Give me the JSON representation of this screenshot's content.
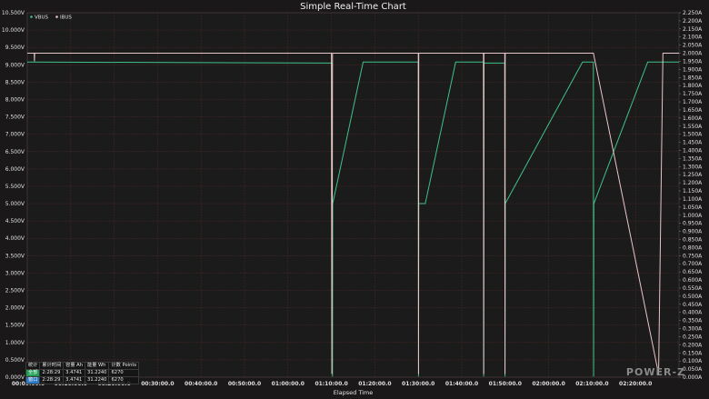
{
  "chart_data": {
    "type": "line",
    "title": "Simple Real-Time Chart",
    "xlabel": "Elapsed Time",
    "x_ticks": [
      "00:00:00.0",
      "00:10:00.0",
      "00:20:00.0",
      "00:30:00.0",
      "00:40:00.0",
      "00:50:00.0",
      "01:00:00.0",
      "01:10:00.0",
      "01:20:00.0",
      "01:30:00.0",
      "01:40:00.0",
      "01:50:00.0",
      "02:00:00.0",
      "02:10:00.0",
      "02:20:00.0"
    ],
    "x_range_minutes": [
      0,
      150
    ],
    "y_left": {
      "ticks": [
        "0.000V",
        "0.500V",
        "1.000V",
        "1.500V",
        "2.000V",
        "2.500V",
        "3.000V",
        "3.500V",
        "4.000V",
        "4.500V",
        "5.000V",
        "5.500V",
        "6.000V",
        "6.500V",
        "7.000V",
        "7.500V",
        "8.000V",
        "8.500V",
        "9.000V",
        "9.500V",
        "10.000V",
        "10.500V"
      ],
      "range": [
        0,
        10.5
      ]
    },
    "y_right": {
      "ticks": [
        "0.000A",
        "0.050A",
        "0.100A",
        "0.150A",
        "0.200A",
        "0.250A",
        "0.300A",
        "0.350A",
        "0.400A",
        "0.450A",
        "0.500A",
        "0.550A",
        "0.600A",
        "0.650A",
        "0.700A",
        "0.750A",
        "0.800A",
        "0.850A",
        "0.900A",
        "0.950A",
        "1.000A",
        "1.050A",
        "1.100A",
        "1.150A",
        "1.200A",
        "1.250A",
        "1.300A",
        "1.350A",
        "1.400A",
        "1.450A",
        "1.500A",
        "1.550A",
        "1.600A",
        "1.650A",
        "1.700A",
        "1.750A",
        "1.800A",
        "1.850A",
        "1.900A",
        "1.950A",
        "2.000A",
        "2.050A",
        "2.100A",
        "2.150A",
        "2.200A",
        "2.250A"
      ],
      "range": [
        0,
        2.25
      ]
    },
    "legend_position": "top-left",
    "grid": true,
    "series": [
      {
        "name": "VBUS",
        "color": "#3fc28a",
        "axis": "left",
        "points": [
          [
            0,
            9.08
          ],
          [
            70.2,
            9.05
          ],
          [
            70.25,
            0.02
          ],
          [
            70.3,
            5.0
          ],
          [
            77.3,
            9.08
          ],
          [
            90,
            9.08
          ],
          [
            90.05,
            0.02
          ],
          [
            90.1,
            5.0
          ],
          [
            91.6,
            5.0
          ],
          [
            98.6,
            9.08
          ],
          [
            105,
            9.08
          ],
          [
            105.05,
            0.02
          ],
          [
            105.1,
            9.05
          ],
          [
            109.9,
            9.05
          ],
          [
            109.95,
            0.02
          ],
          [
            110,
            5.0
          ],
          [
            127.8,
            9.08
          ],
          [
            130.3,
            9.08
          ],
          [
            130.35,
            0.02
          ],
          [
            130.4,
            5.0
          ],
          [
            142.8,
            9.08
          ],
          [
            150,
            9.08
          ]
        ]
      },
      {
        "name": "IBUS",
        "color": "#e8c6c8",
        "axis": "right",
        "points": [
          [
            0,
            2.0
          ],
          [
            1.6,
            2.0
          ],
          [
            1.65,
            1.95
          ],
          [
            1.7,
            2.0
          ],
          [
            70.0,
            2.0
          ],
          [
            70.1,
            0.02
          ],
          [
            70.25,
            2.0
          ],
          [
            90,
            2.0
          ],
          [
            90.05,
            0.02
          ],
          [
            90.1,
            2.0
          ],
          [
            105,
            2.0
          ],
          [
            105.05,
            0.02
          ],
          [
            105.1,
            2.0
          ],
          [
            109.9,
            2.0
          ],
          [
            109.95,
            0.02
          ],
          [
            110,
            2.0
          ],
          [
            130.3,
            2.0
          ],
          [
            145.3,
            0.02
          ],
          [
            146.3,
            2.0
          ],
          [
            150,
            2.0
          ]
        ]
      }
    ]
  },
  "legend": [
    {
      "label": "VBUS",
      "color": "#3fc28a"
    },
    {
      "label": "IBUS",
      "color": "#e8c6c8"
    }
  ],
  "stats": {
    "headers": [
      "统计",
      "累计时间",
      "容量 Ah",
      "能量 Wh",
      "计数 Points"
    ],
    "rows": [
      {
        "tag": "全部",
        "time": "2:28:29",
        "ah": "3.4741",
        "wh": "31.2240",
        "points": "6270"
      },
      {
        "tag": "窗口",
        "time": "2:28:29",
        "ah": "3.4741",
        "wh": "31.2240",
        "points": "6270"
      }
    ]
  },
  "logo": "POWER-Z"
}
